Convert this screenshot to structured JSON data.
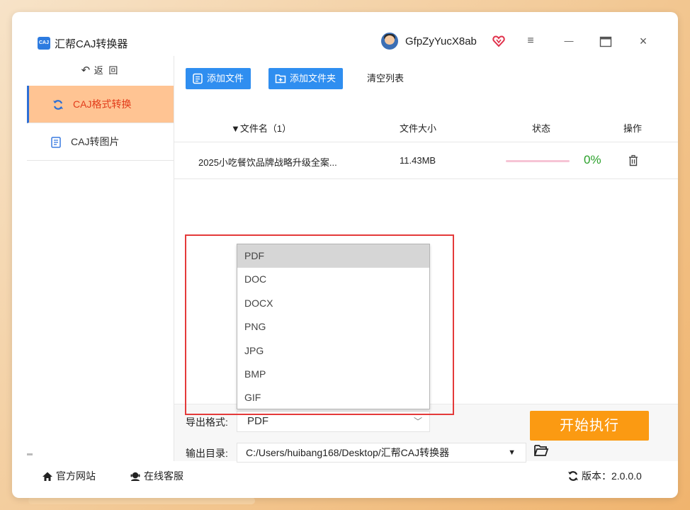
{
  "app": {
    "logo_text": "CAJ",
    "title": "汇帮CAJ转换器"
  },
  "user": {
    "name": "GfpZyYucX8ab"
  },
  "window_controls": {
    "menu": "≡",
    "minimize": "—",
    "close": "×"
  },
  "sidebar": {
    "back_label": "返 回",
    "items": [
      {
        "label": "CAJ格式转换",
        "active": true
      },
      {
        "label": "CAJ转图片",
        "active": false
      }
    ]
  },
  "toolbar": {
    "add_file": "添加文件",
    "add_folder": "添加文件夹",
    "clear_list": "清空列表"
  },
  "table": {
    "headers": {
      "name": "▼文件名（1）",
      "size": "文件大小",
      "status": "状态",
      "action": "操作"
    },
    "rows": [
      {
        "name": "2025小吃餐饮品牌战略升级全案...",
        "size": "11.43MB",
        "progress": 0,
        "percent": "0%"
      }
    ]
  },
  "format_dropdown": {
    "options": [
      "PDF",
      "DOC",
      "DOCX",
      "PNG",
      "JPG",
      "BMP",
      "GIF"
    ],
    "selected_index": 0
  },
  "export": {
    "format_label": "导出格式:",
    "format_value": "PDF",
    "output_label": "输出目录:",
    "output_path": "C:/Users/huibang168/Desktop/汇帮CAJ转换器",
    "start_label": "开始执行"
  },
  "footer": {
    "website": "官方网站",
    "support": "在线客服",
    "version": "版本：2.0.0.0"
  },
  "colors": {
    "accent_blue": "#2f8ef0",
    "active_tab": "#ffc493",
    "active_text": "#e23b1a",
    "start_button": "#fb9a12",
    "highlight_border": "#e43a3a",
    "percent_text": "#2aa02a"
  }
}
